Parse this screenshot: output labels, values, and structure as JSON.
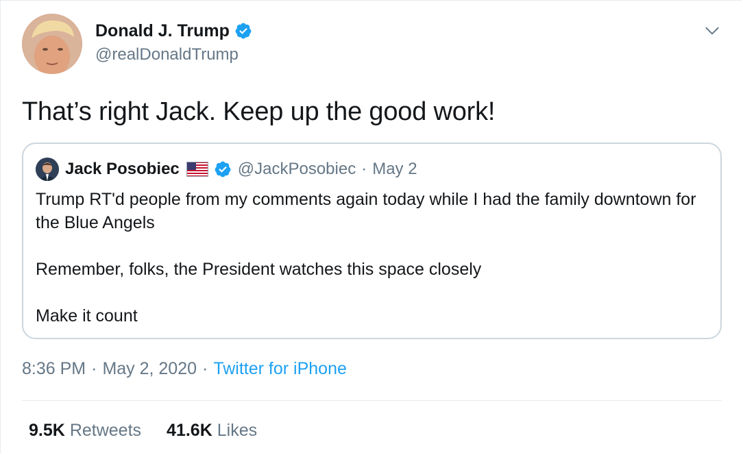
{
  "author": {
    "display_name": "Donald J. Trump",
    "handle": "@realDonaldTrump",
    "verified": true
  },
  "tweet": {
    "text": "That’s right Jack. Keep up the good work!"
  },
  "quoted_tweet": {
    "display_name": "Jack Posobiec",
    "flag_icon": "us-flag-icon",
    "verified": true,
    "handle": "@JackPosobiec",
    "separator": "·",
    "date": "May 2",
    "paragraphs": [
      "Trump RT'd people from my comments again today while I had the family downtown for the Blue Angels",
      "Remember, folks, the President watches this space closely",
      "Make it count"
    ]
  },
  "meta": {
    "time": "8:36 PM",
    "separator": "·",
    "date": "May 2, 2020",
    "source": "Twitter for iPhone"
  },
  "stats": {
    "retweets_count": "9.5K",
    "retweets_label": "Retweets",
    "likes_count": "41.6K",
    "likes_label": "Likes"
  },
  "colors": {
    "accent": "#1da1f2",
    "secondary_text": "#657786",
    "border": "#ccd6dd"
  }
}
